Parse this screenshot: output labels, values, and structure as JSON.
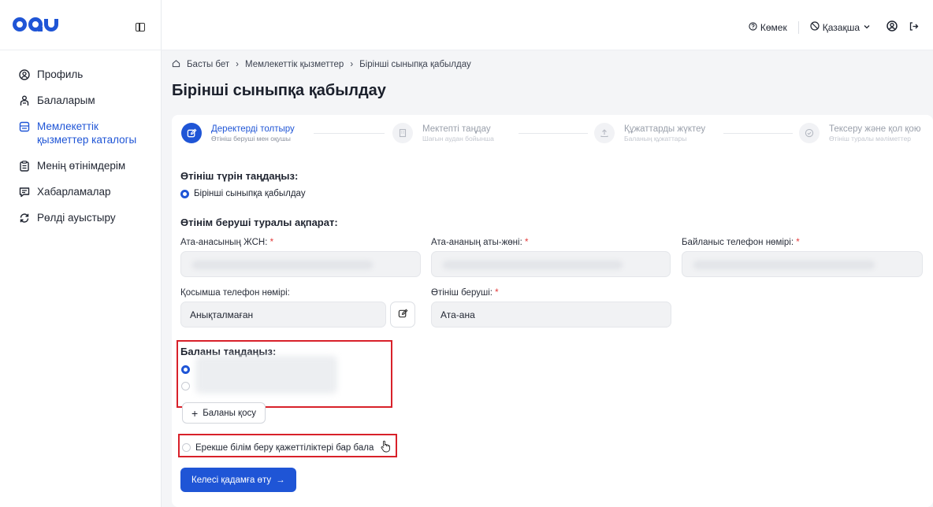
{
  "brand": {
    "logo_icon": "oqu-logo-icon"
  },
  "header": {
    "help_label": "Көмек",
    "language_label": "Қазақша"
  },
  "sidebar": {
    "items": [
      {
        "label": "Профиль",
        "icon": "user-circle-icon"
      },
      {
        "label": "Балаларым",
        "icon": "children-icon"
      },
      {
        "label": "Мемлекеттік қызметтер каталогы",
        "icon": "catalog-icon",
        "active": true
      },
      {
        "label": "Менің өтінімдерім",
        "icon": "clipboard-icon"
      },
      {
        "label": "Хабарламалар",
        "icon": "message-icon"
      },
      {
        "label": "Рөлді ауыстыру",
        "icon": "swap-icon"
      }
    ]
  },
  "breadcrumb": [
    "Басты бет",
    "Мемлекеттік қызметтер",
    "Бірінші сыныпқа қабылдау"
  ],
  "page_title": "Бірінші сыныпқа қабылдау",
  "stepper": [
    {
      "title": "Деректерді толтыру",
      "subtitle": "Өтініш беруші мен оқушы",
      "active": true
    },
    {
      "title": "Мектепті таңдау",
      "subtitle": "Шағын аудан бойынша"
    },
    {
      "title": "Құжаттарды жүктеу",
      "subtitle": "Баланың құжаттары"
    },
    {
      "title": "Тексеру және қол қою",
      "subtitle": "Өтініш туралы мәліметтер"
    }
  ],
  "form": {
    "type_title": "Өтініш түрін таңдаңыз:",
    "type_option": "Бірінші сыныпқа қабылдау",
    "applicant_title": "Өтінім беруші туралы ақпарат:",
    "iin_label": "Ата-анасының ЖСН:",
    "name_label": "Ата-ананың аты-жөні:",
    "phone_label": "Байланыс телефон нөмірі:",
    "extra_phone_label": "Қосымша телефон нөмірі:",
    "extra_phone_value": "Анықталмаған",
    "applicant_label": "Өтініш беруші:",
    "applicant_value": "Ата-ана",
    "required_mark": "*",
    "child_title": "Баланы таңдаңыз:",
    "add_child_label": "Баланы қосу",
    "special_needs_label": "Ерекше білім беру қажеттіліктері бар бала",
    "next_label": "Келесі қадамға өту"
  },
  "colors": {
    "accent": "#1f55d6",
    "highlight_box": "#d8212a"
  }
}
